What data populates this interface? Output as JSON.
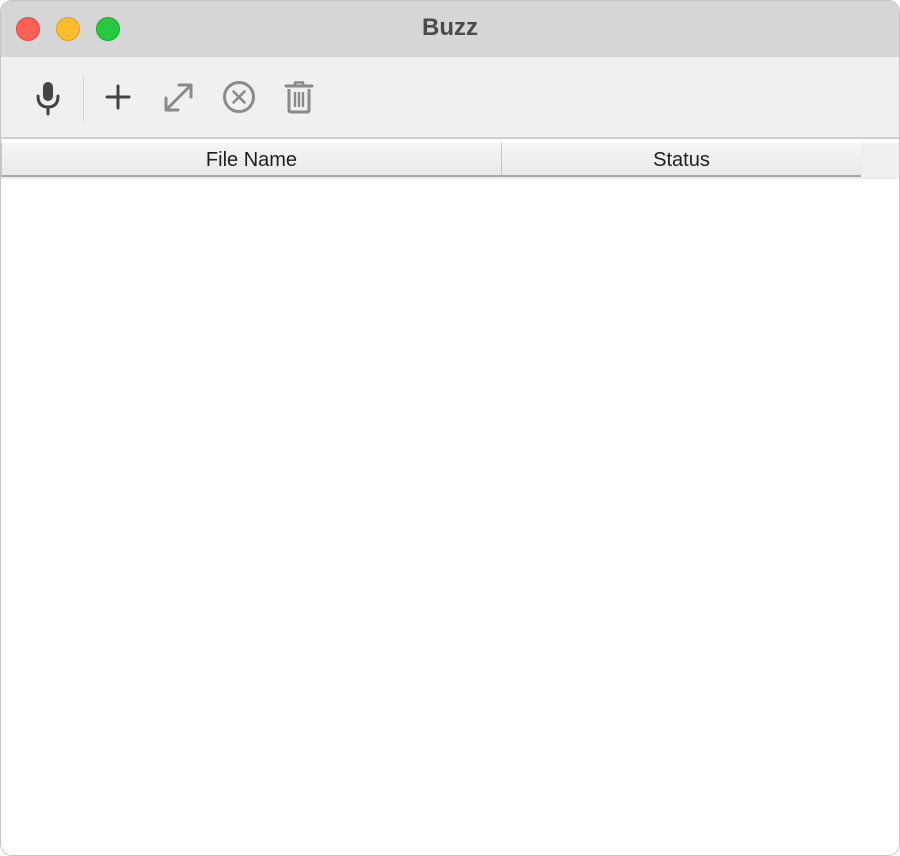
{
  "window": {
    "title": "Buzz"
  },
  "toolbar": {
    "items": [
      {
        "icon": "microphone-icon",
        "action": "record",
        "enabled": true
      },
      {
        "icon": "plus-icon",
        "action": "add",
        "enabled": true
      },
      {
        "icon": "expand-icon",
        "action": "open",
        "enabled": false
      },
      {
        "icon": "cancel-circle-icon",
        "action": "stop",
        "enabled": false
      },
      {
        "icon": "trash-icon",
        "action": "delete",
        "enabled": false
      }
    ]
  },
  "table": {
    "columns": [
      "File Name",
      "Status"
    ],
    "rows": []
  },
  "colors": {
    "close": "#fe5f57",
    "minimize": "#febc2e",
    "maximize": "#28c840",
    "enabled_icon": "#444444",
    "disabled_icon": "#8a8a8a"
  }
}
